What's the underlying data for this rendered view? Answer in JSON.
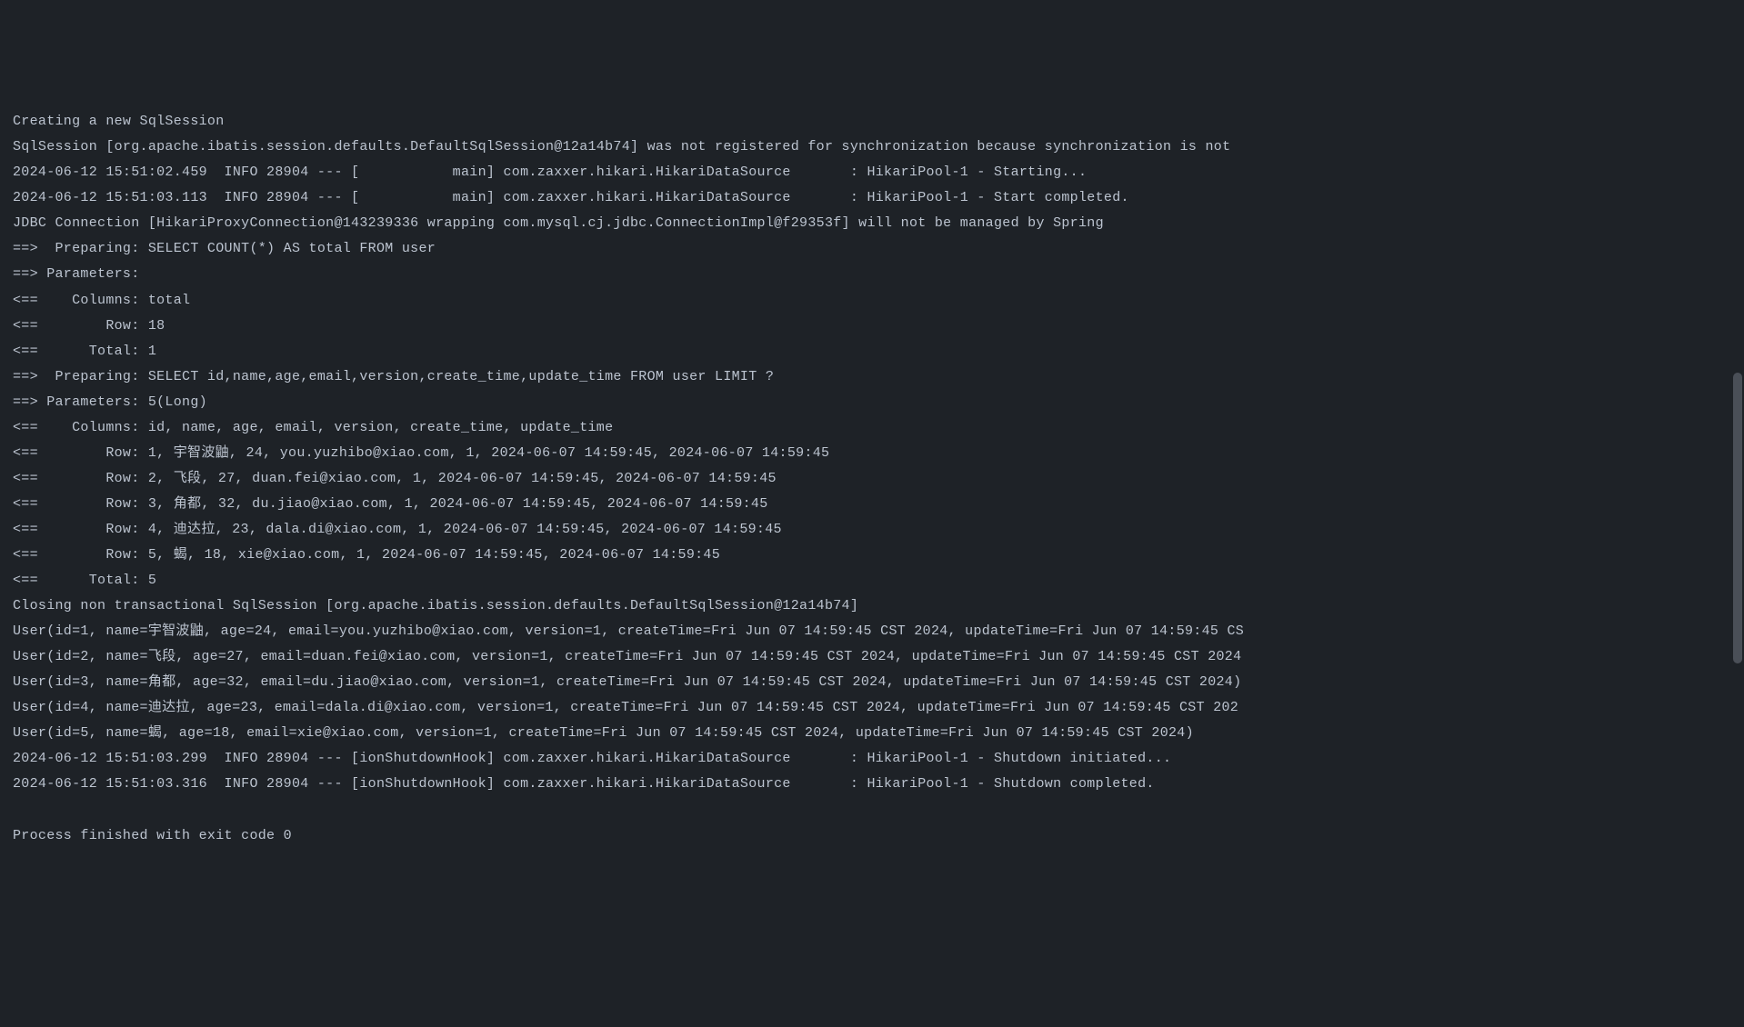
{
  "lines": [
    "Creating a new SqlSession",
    "SqlSession [org.apache.ibatis.session.defaults.DefaultSqlSession@12a14b74] was not registered for synchronization because synchronization is not",
    "2024-06-12 15:51:02.459  INFO 28904 --- [           main] com.zaxxer.hikari.HikariDataSource       : HikariPool-1 - Starting...",
    "2024-06-12 15:51:03.113  INFO 28904 --- [           main] com.zaxxer.hikari.HikariDataSource       : HikariPool-1 - Start completed.",
    "JDBC Connection [HikariProxyConnection@143239336 wrapping com.mysql.cj.jdbc.ConnectionImpl@f29353f] will not be managed by Spring",
    "==>  Preparing: SELECT COUNT(*) AS total FROM user",
    "==> Parameters: ",
    "<==    Columns: total",
    "<==        Row: 18",
    "<==      Total: 1",
    "==>  Preparing: SELECT id,name,age,email,version,create_time,update_time FROM user LIMIT ?",
    "==> Parameters: 5(Long)",
    "<==    Columns: id, name, age, email, version, create_time, update_time",
    "<==        Row: 1, 宇智波鼬, 24, you.yuzhibo@xiao.com, 1, 2024-06-07 14:59:45, 2024-06-07 14:59:45",
    "<==        Row: 2, 飞段, 27, duan.fei@xiao.com, 1, 2024-06-07 14:59:45, 2024-06-07 14:59:45",
    "<==        Row: 3, 角都, 32, du.jiao@xiao.com, 1, 2024-06-07 14:59:45, 2024-06-07 14:59:45",
    "<==        Row: 4, 迪达拉, 23, dala.di@xiao.com, 1, 2024-06-07 14:59:45, 2024-06-07 14:59:45",
    "<==        Row: 5, 蝎, 18, xie@xiao.com, 1, 2024-06-07 14:59:45, 2024-06-07 14:59:45",
    "<==      Total: 5",
    "Closing non transactional SqlSession [org.apache.ibatis.session.defaults.DefaultSqlSession@12a14b74]",
    "User(id=1, name=宇智波鼬, age=24, email=you.yuzhibo@xiao.com, version=1, createTime=Fri Jun 07 14:59:45 CST 2024, updateTime=Fri Jun 07 14:59:45 CS",
    "User(id=2, name=飞段, age=27, email=duan.fei@xiao.com, version=1, createTime=Fri Jun 07 14:59:45 CST 2024, updateTime=Fri Jun 07 14:59:45 CST 2024",
    "User(id=3, name=角都, age=32, email=du.jiao@xiao.com, version=1, createTime=Fri Jun 07 14:59:45 CST 2024, updateTime=Fri Jun 07 14:59:45 CST 2024)",
    "User(id=4, name=迪达拉, age=23, email=dala.di@xiao.com, version=1, createTime=Fri Jun 07 14:59:45 CST 2024, updateTime=Fri Jun 07 14:59:45 CST 202",
    "User(id=5, name=蝎, age=18, email=xie@xiao.com, version=1, createTime=Fri Jun 07 14:59:45 CST 2024, updateTime=Fri Jun 07 14:59:45 CST 2024)",
    "2024-06-12 15:51:03.299  INFO 28904 --- [ionShutdownHook] com.zaxxer.hikari.HikariDataSource       : HikariPool-1 - Shutdown initiated...",
    "2024-06-12 15:51:03.316  INFO 28904 --- [ionShutdownHook] com.zaxxer.hikari.HikariDataSource       : HikariPool-1 - Shutdown completed.",
    "",
    "Process finished with exit code 0"
  ]
}
